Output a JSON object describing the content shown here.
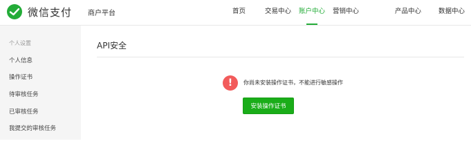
{
  "header": {
    "brand": "微信支付",
    "platform": "商户平台",
    "nav": [
      {
        "label": "首页"
      },
      {
        "label": "交易中心"
      },
      {
        "label": "账户中心",
        "active": true
      },
      {
        "label": "营销中心"
      },
      {
        "label": "产品中心"
      },
      {
        "label": "数据中心"
      }
    ]
  },
  "sidebar": {
    "group_title": "个人设置",
    "items": [
      {
        "label": "个人信息"
      },
      {
        "label": "操作证书"
      },
      {
        "label": "待审核任务"
      },
      {
        "label": "已审核任务"
      },
      {
        "label": "我提交的审核任务"
      }
    ]
  },
  "main": {
    "title": "API安全",
    "warning_icon": "!",
    "warning_text": "你尚未安装操作证书，不能进行敏感操作",
    "install_button": "安装操作证书"
  },
  "colors": {
    "brand_green": "#23ac38",
    "button_green": "#1aad19",
    "warning_red": "#f25b5b",
    "sidebar_bg": "#f5f5f5"
  },
  "icons": {
    "logo": "wechat-pay-logo-icon",
    "warning": "exclamation-circle-icon"
  }
}
